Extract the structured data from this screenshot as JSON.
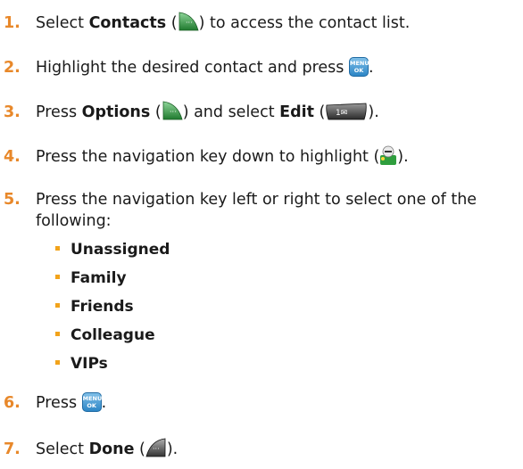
{
  "steps": [
    {
      "num": "1.",
      "pre": "Select ",
      "bold": "Contacts",
      "post1": " (",
      "post2": ") to access the contact list.",
      "icon": "softkey-right-icon"
    },
    {
      "num": "2.",
      "pre": "Highlight the desired contact and press ",
      "icon": "menu-ok-key-icon",
      "post": "."
    },
    {
      "num": "3.",
      "pre": "Press ",
      "bold": "Options",
      "mid1": " (",
      "mid2": ") and select ",
      "bold2": "Edit",
      "post1": " (",
      "post2": ").",
      "icon1": "softkey-right-icon",
      "icon2": "edit-key-icon"
    },
    {
      "num": "4.",
      "pre": "Press the navigation key down to highlight (",
      "post": ").",
      "icon": "contact-group-icon"
    },
    {
      "num": "5.",
      "line1": "Press the navigation key left or right to select one of the",
      "line2": "following:"
    },
    {
      "num": "6.",
      "pre": "Press ",
      "icon": "menu-ok-key-icon",
      "post": "."
    },
    {
      "num": "7.",
      "pre": "Select ",
      "bold": "Done",
      "post1": " (",
      "post2": ").",
      "icon": "softkey-left-icon"
    }
  ],
  "options": [
    "Unassigned",
    "Family",
    "Friends",
    "Colleague",
    "VIPs"
  ],
  "menu_ok": {
    "top": "MENU",
    "bottom": "OK"
  },
  "colors": {
    "number": "#e8882a",
    "bullet": "#f2a31b",
    "key_blue": "#2d86c6",
    "softkey_green": "#2e8b3a"
  }
}
